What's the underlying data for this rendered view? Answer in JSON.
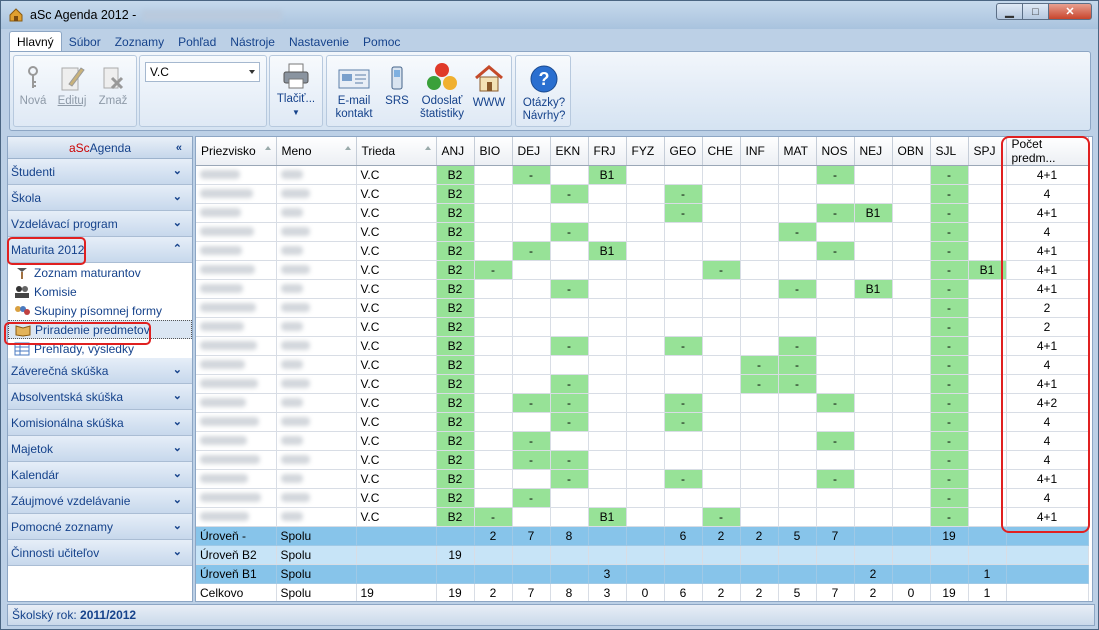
{
  "window": {
    "title": "aSc Agenda 2012 -"
  },
  "menu": {
    "tabs": [
      "Hlavný",
      "Súbor",
      "Zoznamy",
      "Pohľad",
      "Nástroje",
      "Nastavenie",
      "Pomoc"
    ]
  },
  "ribbon": {
    "nova": "Nová",
    "edituj": "Edituj",
    "zmaz": "Zmaž",
    "combo_value": "V.C",
    "tlacit": "Tlačiť...",
    "email_1": "E-mail",
    "email_2": "kontakt",
    "srs": "SRS",
    "odoslat_1": "Odoslať",
    "odoslat_2": "štatistiky",
    "www": "WWW",
    "otazky_1": "Otázky?",
    "otazky_2": "Návrhy?"
  },
  "sidebar": {
    "brand_a": "aSc",
    "brand_b": "Agenda",
    "sections_top": [
      "Študenti",
      "Škola",
      "Vzdelávací program"
    ],
    "maturita": "Maturita 2012",
    "subitems": [
      "Zoznam maturantov",
      "Komisie",
      "Skupiny písomnej formy",
      "Priradenie predmetov",
      "Prehľady, výsledky"
    ],
    "sections_bottom": [
      "Záverečná skúška",
      "Absolventská skúška",
      "Komisionálna skúška",
      "Majetok",
      "Kalendár",
      "Záujmové vzdelávanie",
      "Pomocné zoznamy",
      "Činnosti učiteľov"
    ]
  },
  "status": {
    "label": "Školský rok:",
    "value": "2011/2012"
  },
  "grid": {
    "headers": [
      "Priezvisko",
      "Meno",
      "Trieda",
      "ANJ",
      "BIO",
      "DEJ",
      "EKN",
      "FRJ",
      "FYZ",
      "GEO",
      "CHE",
      "INF",
      "MAT",
      "NOS",
      "NEJ",
      "OBN",
      "SJL",
      "SPJ",
      "Počet predm..."
    ],
    "rows": [
      {
        "trieda": "V.C",
        "s": [
          "B2",
          "",
          "-",
          "",
          "B1",
          "",
          "",
          "",
          "",
          "",
          "-",
          "",
          "",
          "-",
          ""
        ],
        "p": "4+1"
      },
      {
        "trieda": "V.C",
        "s": [
          "B2",
          "",
          "",
          "-",
          "",
          "",
          "-",
          "",
          "",
          "",
          "",
          "",
          "",
          "-",
          ""
        ],
        "p": "4"
      },
      {
        "trieda": "V.C",
        "s": [
          "B2",
          "",
          "",
          "",
          "",
          "",
          "-",
          "",
          "",
          "",
          "-",
          "B1",
          "",
          "-",
          ""
        ],
        "p": "4+1"
      },
      {
        "trieda": "V.C",
        "s": [
          "B2",
          "",
          "",
          "-",
          "",
          "",
          "",
          "",
          "",
          "-",
          "",
          "",
          "",
          "-",
          ""
        ],
        "p": "4"
      },
      {
        "trieda": "V.C",
        "s": [
          "B2",
          "",
          "-",
          "",
          "B1",
          "",
          "",
          "",
          "",
          "",
          "-",
          "",
          "",
          "-",
          ""
        ],
        "p": "4+1"
      },
      {
        "trieda": "V.C",
        "s": [
          "B2",
          "-",
          "",
          "",
          "",
          "",
          "",
          "-",
          "",
          "",
          "",
          "",
          "",
          "-",
          "B1"
        ],
        "p": "4+1"
      },
      {
        "trieda": "V.C",
        "s": [
          "B2",
          "",
          "",
          "-",
          "",
          "",
          "",
          "",
          "",
          "-",
          "",
          "B1",
          "",
          "-",
          ""
        ],
        "p": "4+1"
      },
      {
        "trieda": "V.C",
        "s": [
          "B2",
          "",
          "",
          "",
          "",
          "",
          "",
          "",
          "",
          "",
          "",
          "",
          "",
          "-",
          ""
        ],
        "p": "2"
      },
      {
        "trieda": "V.C",
        "s": [
          "B2",
          "",
          "",
          "",
          "",
          "",
          "",
          "",
          "",
          "",
          "",
          "",
          "",
          "-",
          ""
        ],
        "p": "2"
      },
      {
        "trieda": "V.C",
        "s": [
          "B2",
          "",
          "",
          "-",
          "",
          "",
          "-",
          "",
          "",
          "-",
          "",
          "",
          "",
          "-",
          ""
        ],
        "p": "4+1"
      },
      {
        "trieda": "V.C",
        "s": [
          "B2",
          "",
          "",
          "",
          "",
          "",
          "",
          "",
          "-",
          "-",
          "",
          "",
          "",
          "-",
          ""
        ],
        "p": "4"
      },
      {
        "trieda": "V.C",
        "s": [
          "B2",
          "",
          "",
          "-",
          "",
          "",
          "",
          "",
          "-",
          "-",
          "",
          "",
          "",
          "-",
          ""
        ],
        "p": "4+1"
      },
      {
        "trieda": "V.C",
        "s": [
          "B2",
          "",
          "-",
          "-",
          "",
          "",
          "-",
          "",
          "",
          "",
          "-",
          "",
          "",
          "-",
          ""
        ],
        "p": "4+2"
      },
      {
        "trieda": "V.C",
        "s": [
          "B2",
          "",
          "",
          "-",
          "",
          "",
          "-",
          "",
          "",
          "",
          "",
          "",
          "",
          "-",
          ""
        ],
        "p": "4"
      },
      {
        "trieda": "V.C",
        "s": [
          "B2",
          "",
          "-",
          "",
          "",
          "",
          "",
          "",
          "",
          "",
          "-",
          "",
          "",
          "-",
          ""
        ],
        "p": "4"
      },
      {
        "trieda": "V.C",
        "s": [
          "B2",
          "",
          "-",
          "-",
          "",
          "",
          "",
          "",
          "",
          "",
          "",
          "",
          "",
          "-",
          ""
        ],
        "p": "4"
      },
      {
        "trieda": "V.C",
        "s": [
          "B2",
          "",
          "",
          "-",
          "",
          "",
          "-",
          "",
          "",
          "",
          "-",
          "",
          "",
          "-",
          ""
        ],
        "p": "4+1"
      },
      {
        "trieda": "V.C",
        "s": [
          "B2",
          "",
          "-",
          "",
          "",
          "",
          "",
          "",
          "",
          "",
          "",
          "",
          "",
          "-",
          ""
        ],
        "p": "4"
      },
      {
        "trieda": "V.C",
        "s": [
          "B2",
          "-",
          "",
          "",
          "B1",
          "",
          "",
          "-",
          "",
          "",
          "",
          "",
          "",
          "-",
          ""
        ],
        "p": "4+1"
      }
    ],
    "summary": [
      {
        "a": "Úroveň -",
        "b": "Spolu",
        "c": "",
        "s": [
          "",
          "2",
          "7",
          "8",
          "",
          "",
          "6",
          "2",
          "2",
          "5",
          "7",
          "",
          "",
          "19",
          ""
        ],
        "p": "",
        "cls": "sum"
      },
      {
        "a": "Úroveň B2",
        "b": "Spolu",
        "c": "",
        "s": [
          "19",
          "",
          "",
          "",
          "",
          "",
          "",
          "",
          "",
          "",
          "",
          "",
          "",
          "",
          ""
        ],
        "p": "",
        "cls": "sum2"
      },
      {
        "a": "Úroveň B1",
        "b": "Spolu",
        "c": "",
        "s": [
          "",
          "",
          "",
          "",
          "3",
          "",
          "",
          "",
          "",
          "",
          "",
          "2",
          "",
          "",
          "1"
        ],
        "p": "",
        "cls": "sum"
      },
      {
        "a": "Celkovo",
        "b": "Spolu",
        "c": "19",
        "s": [
          "19",
          "2",
          "7",
          "8",
          "3",
          "0",
          "6",
          "2",
          "2",
          "5",
          "7",
          "2",
          "0",
          "19",
          "1"
        ],
        "p": "",
        "cls": "tot"
      }
    ]
  }
}
